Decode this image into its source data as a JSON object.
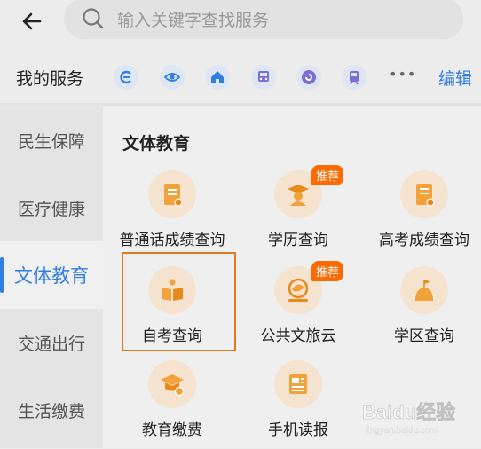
{
  "header": {
    "back_icon": "arrow-left-icon",
    "search_icon": "search-icon",
    "search_placeholder": "输入关键字查找服务"
  },
  "service_bar": {
    "title": "我的服务",
    "icons": [
      "service-app-icon-1",
      "eye-icon",
      "home-icon",
      "bus-icon",
      "circle-app-icon",
      "train-icon"
    ],
    "more_label": "•••",
    "edit_label": "编辑"
  },
  "sidebar": {
    "items": [
      {
        "label": "民生保障"
      },
      {
        "label": "医疗健康"
      },
      {
        "label": "文体教育"
      },
      {
        "label": "交通出行"
      },
      {
        "label": "生活缴费"
      }
    ],
    "active_index": 2
  },
  "main": {
    "section_title": "文体教育",
    "tiles": [
      {
        "label": "普通话成绩查询",
        "icon": "certificate-icon"
      },
      {
        "label": "学历查询",
        "icon": "graduate-icon",
        "badge": "推荐"
      },
      {
        "label": "高考成绩查询",
        "icon": "exam-certificate-icon"
      },
      {
        "label": "自考查询",
        "icon": "book-reader-icon"
      },
      {
        "label": "公共文旅云",
        "icon": "culture-logo-icon",
        "badge": "推荐"
      },
      {
        "label": "学区查询",
        "icon": "school-flag-icon"
      },
      {
        "label": "教育缴费",
        "icon": "mortarboard-coin-icon"
      },
      {
        "label": "手机读报",
        "icon": "newspaper-icon"
      }
    ]
  },
  "watermark": {
    "text": "Baidu经验",
    "subtext": "jingyan.baidu.com"
  },
  "colors": {
    "accent": "#2f7ee0",
    "badge": "#ff6a00",
    "icon_orange": "#f2a23a",
    "icon_bg": "#f5e3cf",
    "highlight": "#e07a1f"
  }
}
